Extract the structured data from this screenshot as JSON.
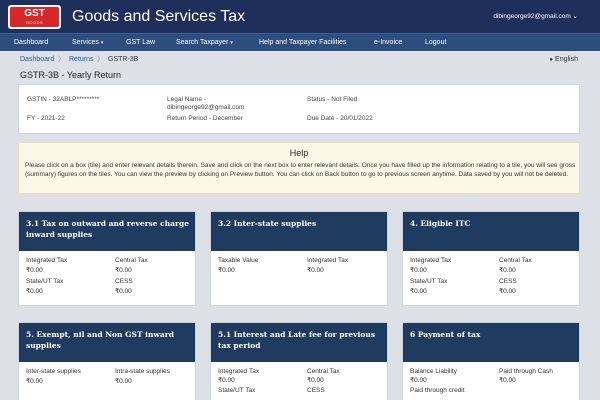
{
  "header": {
    "logo_main": "GST",
    "logo_sub": "GOODS",
    "title": "Goods and Services Tax",
    "user_email": "dibingeorge92@gmail.com",
    "user_caret": "⌄"
  },
  "nav": {
    "items": [
      {
        "label": "Dashboard"
      },
      {
        "label": "Services",
        "caret": "▾"
      },
      {
        "label": "GST Law"
      },
      {
        "label": "Search Taxpayer",
        "caret": "▾"
      },
      {
        "label": "Help and Taxpayer Facilities"
      },
      {
        "label": "e-Invoice"
      },
      {
        "label": "Logout"
      }
    ]
  },
  "breadcrumb": {
    "items": [
      "Dashboard",
      "Returns",
      "GSTR-3B"
    ],
    "separator": "〉"
  },
  "language": {
    "icon": "globe-icon",
    "glyph": "●",
    "label": "English"
  },
  "page_title": "GSTR-3B - Yearly Return",
  "info": {
    "gstin": "GSTIN - 32ABLP*********",
    "legal_name_label": "Legal Name -",
    "legal_name_value": "dibingeorge92@gmail.com",
    "status": "Status - Not Filed",
    "fy": "FY - 2021-22",
    "return_period": "Return Period - December",
    "due_date": "Due Date - 20/01/2022"
  },
  "help": {
    "title": "Help",
    "text": "Please click on a box (tile) and enter relevant details therein. Save and click on the next box to enter relevant details. Once you have filled up the information relating to a tile, you will see gross (summary) figures on the tiles. You can view the preview by clicking on Preview button. You can click on Back button to go to previous screen anytime. Data saved by you will not be deleted."
  },
  "tiles": [
    {
      "title": "3.1 Tax on outward and reverse charge inward supplies",
      "fields": [
        {
          "label": "Integrated Tax",
          "value": "₹0.00"
        },
        {
          "label": "Central Tax",
          "value": "₹0.00"
        },
        {
          "label": "State/UT Tax",
          "value": "₹0.00"
        },
        {
          "label": "CESS",
          "value": "₹0.00"
        }
      ]
    },
    {
      "title": "3.2 Inter-state supplies",
      "fields": [
        {
          "label": "Taxable Value",
          "value": "₹0.00"
        },
        {
          "label": "Integrated Tax",
          "value": "₹0.00"
        }
      ]
    },
    {
      "title": "4. Eligible ITC",
      "fields": [
        {
          "label": "Integrated Tax",
          "value": "₹0.00"
        },
        {
          "label": "Central Tax",
          "value": "₹0.00"
        },
        {
          "label": "State/UT Tax",
          "value": "₹0.00"
        },
        {
          "label": "CESS",
          "value": "₹0.00"
        }
      ]
    },
    {
      "title": "5. Exempt, nil and Non GST inward supplies",
      "fields": [
        {
          "label": "Inter-state supplies",
          "value": "₹0.00"
        },
        {
          "label": "Intra-state supplies",
          "value": "₹0.00"
        }
      ]
    },
    {
      "title": "5.1 Interest and Late fee for previous tax period",
      "fields": [
        {
          "label": "Integrated Tax",
          "value": "₹0.00"
        },
        {
          "label": "Central Tax",
          "value": "₹0.00"
        },
        {
          "label": "State/UT Tax"
        },
        {
          "label": "CESS"
        }
      ]
    },
    {
      "title": "6 Payment of tax",
      "fields": [
        {
          "label": "Balance Liability",
          "value": "₹0.00"
        },
        {
          "label": "Paid through Cash",
          "value": "₹0.00"
        },
        {
          "label": "Paid through credit"
        }
      ]
    }
  ]
}
